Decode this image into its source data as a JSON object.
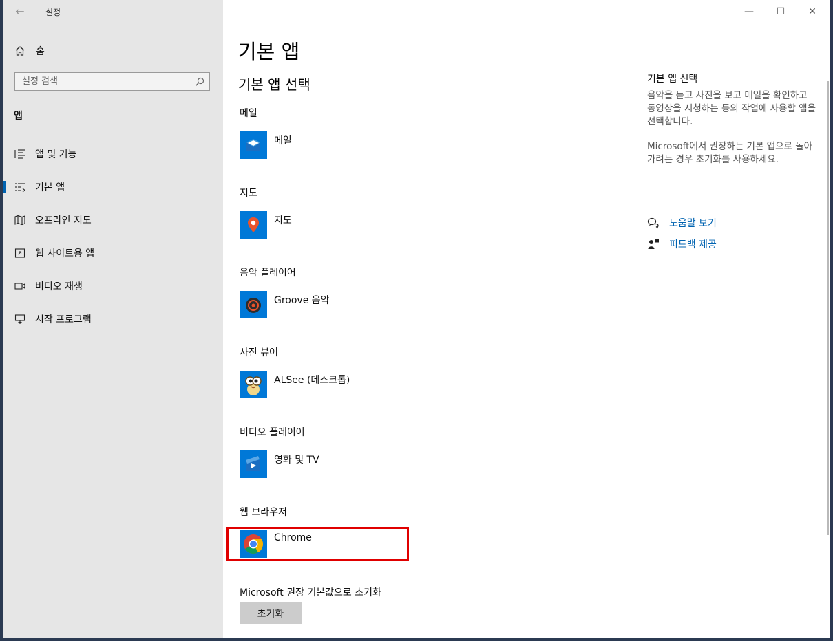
{
  "window": {
    "title": "설정"
  },
  "sidebar": {
    "home_label": "홈",
    "search_placeholder": "설정 검색",
    "section": "앱",
    "items": [
      {
        "label": "앱 및 기능",
        "icon": "list-icon",
        "active": false
      },
      {
        "label": "기본 앱",
        "icon": "default-apps-icon",
        "active": true
      },
      {
        "label": "오프라인 지도",
        "icon": "map-icon",
        "active": false
      },
      {
        "label": "웹 사이트용 앱",
        "icon": "website-app-icon",
        "active": false
      },
      {
        "label": "비디오 재생",
        "icon": "video-icon",
        "active": false
      },
      {
        "label": "시작 프로그램",
        "icon": "startup-icon",
        "active": false
      }
    ]
  },
  "main": {
    "page_title": "기본 앱",
    "section_title": "기본 앱 선택",
    "categories": [
      {
        "label": "메일",
        "app": "메일",
        "icon": "mail-icon",
        "color": "#0078d7"
      },
      {
        "label": "지도",
        "app": "지도",
        "icon": "maps-pin-icon",
        "color": "#0078d7"
      },
      {
        "label": "음악 플레이어",
        "app": "Groove 음악",
        "icon": "groove-music-icon",
        "color": "#0078d7"
      },
      {
        "label": "사진 뷰어",
        "app": "ALSee (데스크톱)",
        "icon": "alsee-icon",
        "color": "#0078d7"
      },
      {
        "label": "비디오 플레이어",
        "app": "영화 및 TV",
        "icon": "movies-tv-icon",
        "color": "#0078d7"
      },
      {
        "label": "웹 브라우저",
        "app": "Chrome",
        "icon": "chrome-icon",
        "color": "#0078d7"
      }
    ],
    "reset_label": "Microsoft 권장 기본값으로 초기화",
    "reset_button": "초기화"
  },
  "right_panel": {
    "title": "기본 앱 선택",
    "para1": "음악을 듣고 사진을 보고 메일을 확인하고 동영상을 시청하는 등의 작업에 사용할 앱을 선택합니다.",
    "para2": "Microsoft에서 권장하는 기본 앱으로 돌아가려는 경우 초기화를 사용하세요.",
    "links": [
      {
        "label": "도움말 보기",
        "icon": "help-chat-icon"
      },
      {
        "label": "피드백 제공",
        "icon": "feedback-icon"
      }
    ]
  },
  "colors": {
    "accent": "#0063b1",
    "tile": "#0078d7",
    "highlight": "#e00000",
    "sidebar": "#e6e6e6"
  }
}
